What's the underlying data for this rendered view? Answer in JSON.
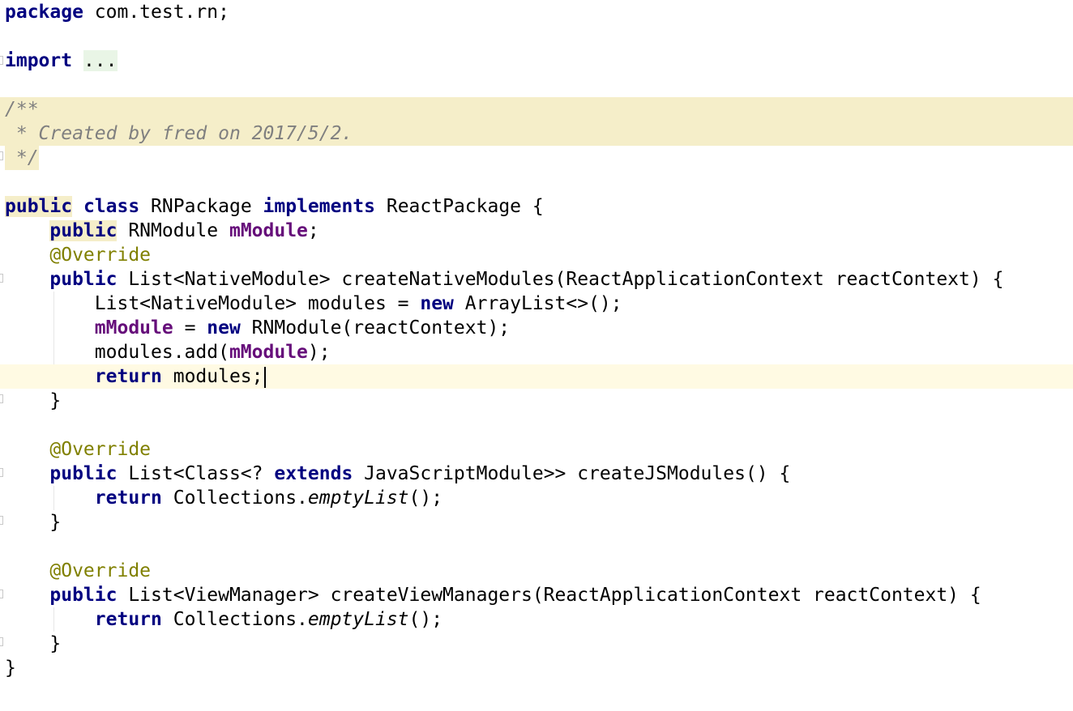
{
  "editor": {
    "language": "Java",
    "lines": {
      "l1": {
        "kw_package": "package",
        "pkg": " com.test.rn;"
      },
      "l3": {
        "kw_import": "import",
        "sp": " ",
        "folded": "..."
      },
      "l5": {
        "text": "/**"
      },
      "l6": {
        "text": " * Created by fred on 2017/5/2."
      },
      "l7": {
        "text": " */"
      },
      "l9": {
        "kw_public": "public",
        "sp1": " ",
        "kw_class": "class",
        "name": " RNPackage ",
        "kw_implements": "implements",
        "rest": " ReactPackage {"
      },
      "l10": {
        "indent": "    ",
        "kw_public": "public",
        "type": " RNModule ",
        "field": "mModule",
        "semi": ";"
      },
      "l11": {
        "indent": "    ",
        "anno": "@Override"
      },
      "l12": {
        "indent": "    ",
        "kw_public": "public",
        "rest": " List<NativeModule> createNativeModules(ReactApplicationContext reactContext) {"
      },
      "l13": {
        "indent": "        ",
        "pre": "List<NativeModule> modules = ",
        "kw_new": "new",
        "rest": " ArrayList<>();"
      },
      "l14": {
        "indent": "        ",
        "field": "mModule",
        "mid": " = ",
        "kw_new": "new",
        "rest": " RNModule(reactContext);"
      },
      "l15": {
        "indent": "        ",
        "pre": "modules.add(",
        "field": "mModule",
        "rest": ");"
      },
      "l16": {
        "indent": "        ",
        "kw_return": "return",
        "rest": " modules;"
      },
      "l17": {
        "text": "    }"
      },
      "l19": {
        "indent": "    ",
        "anno": "@Override"
      },
      "l20": {
        "indent": "    ",
        "kw_public": "public",
        "pre": " List<Class<? ",
        "kw_extends": "extends",
        "rest": " JavaScriptModule>> createJSModules() {"
      },
      "l21": {
        "indent": "        ",
        "kw_return": "return",
        "pre": " Collections.",
        "italic": "emptyList",
        "rest": "();"
      },
      "l22": {
        "text": "    }"
      },
      "l24": {
        "indent": "    ",
        "anno": "@Override"
      },
      "l25": {
        "indent": "    ",
        "kw_public": "public",
        "rest": " List<ViewManager> createViewManagers(ReactApplicationContext reactContext) {"
      },
      "l26": {
        "indent": "        ",
        "kw_return": "return",
        "pre": " Collections.",
        "italic": "emptyList",
        "rest": "();"
      },
      "l27": {
        "text": "    }"
      },
      "l28": {
        "text": "}"
      }
    }
  }
}
